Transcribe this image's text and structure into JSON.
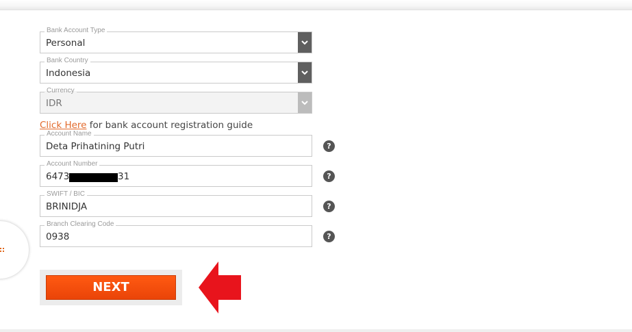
{
  "form": {
    "bank_account_type": {
      "label": "Bank Account Type",
      "value": "Personal"
    },
    "bank_country": {
      "label": "Bank Country",
      "value": "Indonesia"
    },
    "currency": {
      "label": "Currency",
      "value": "IDR"
    },
    "guide": {
      "link_text": "Click Here",
      "text": " for bank account registration guide"
    },
    "account_name": {
      "label": "Account Name",
      "value": "Deta Prihatining Putri"
    },
    "account_number": {
      "label": "Account Number",
      "value_start": "6473",
      "value_end": "31"
    },
    "swift_bic": {
      "label": "SWIFT / BIC",
      "value": "BRINIDJA"
    },
    "branch_clearing_code": {
      "label": "Branch Clearing Code",
      "value": "0938"
    },
    "help_glyph": "?",
    "next_label": "NEXT"
  },
  "colors": {
    "accent": "#f04a0c",
    "annotation_arrow": "#e8141c",
    "select_arrow_bg": "#5f5f5f",
    "link": "#e26a2c"
  },
  "icons": {
    "select": "chevron-down-icon",
    "help": "question-circle-icon",
    "annotation": "arrow-left-icon"
  }
}
